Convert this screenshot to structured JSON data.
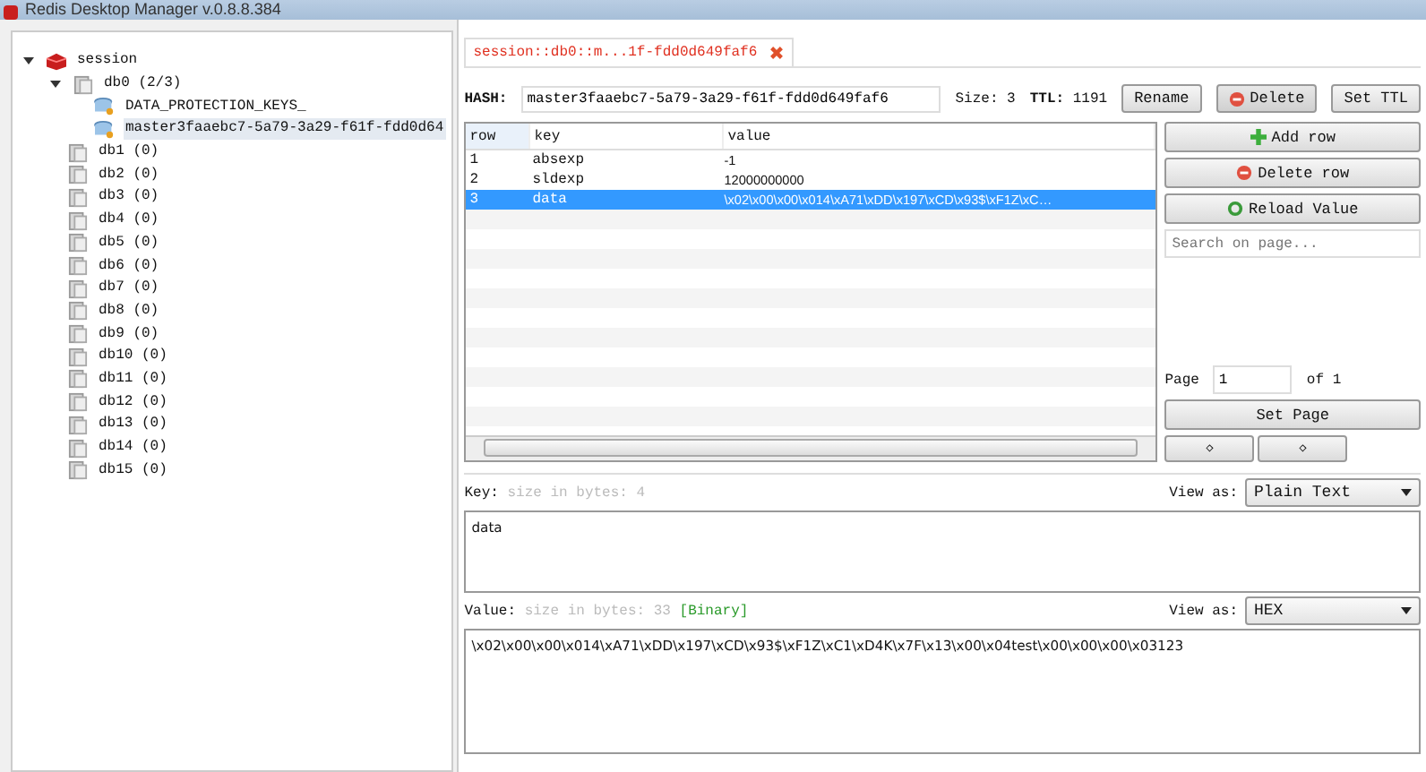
{
  "window": {
    "title": "Redis Desktop Manager v.0.8.8.384"
  },
  "tree": [
    {
      "kind": "server",
      "label": "session",
      "expanded": true,
      "children": [
        {
          "kind": "db",
          "label": "db0  (2/3)",
          "expanded": true,
          "children": [
            {
              "kind": "key",
              "label": "DATA_PROTECTION_KEYS_",
              "selected": false
            },
            {
              "kind": "key",
              "label": "master3faaebc7-5a79-3a29-f61f-fdd0d64",
              "selected": true
            }
          ]
        },
        {
          "kind": "db",
          "label": "db1 (0)",
          "selected": false
        },
        {
          "kind": "db",
          "label": "db2 (0)",
          "selected": false
        },
        {
          "kind": "db",
          "label": "db3 (0)",
          "selected": false
        },
        {
          "kind": "db",
          "label": "db4 (0)",
          "selected": false
        },
        {
          "kind": "db",
          "label": "db5 (0)",
          "selected": false
        },
        {
          "kind": "db",
          "label": "db6 (0)",
          "selected": false
        },
        {
          "kind": "db",
          "label": "db7 (0)",
          "selected": false
        },
        {
          "kind": "db",
          "label": "db8 (0)",
          "selected": false
        },
        {
          "kind": "db",
          "label": "db9 (0)",
          "selected": false
        },
        {
          "kind": "db",
          "label": "db10 (0)",
          "selected": false
        },
        {
          "kind": "db",
          "label": "db11 (0)",
          "selected": false
        },
        {
          "kind": "db",
          "label": "db12 (0)",
          "selected": false
        },
        {
          "kind": "db",
          "label": "db13 (0)",
          "selected": false
        },
        {
          "kind": "db",
          "label": "db14 (0)",
          "selected": false
        },
        {
          "kind": "db",
          "label": "db15 (0)",
          "selected": false
        }
      ]
    }
  ],
  "tabs": [
    {
      "label": "session::db0::m...1f-fdd0d649faf6",
      "selected": true
    }
  ],
  "key_header": {
    "type_label": "HASH:",
    "name": "master3faaebc7-5a79-3a29-f61f-fdd0d649faf6",
    "size_label": "Size:",
    "size": "3",
    "ttl_label": "TTL:",
    "ttl": "1191",
    "buttons": [
      {
        "kind": "plain",
        "label": "Rename"
      },
      {
        "kind": "delete",
        "label": "Delete"
      },
      {
        "kind": "plain",
        "label": "Set TTL"
      }
    ]
  },
  "table": {
    "columns": [
      "row",
      "key",
      "value"
    ],
    "rows": [
      {
        "cells": [
          "1",
          "absexp",
          "-1"
        ],
        "selected": false
      },
      {
        "cells": [
          "2",
          "sldexp",
          "12000000000"
        ],
        "selected": false
      },
      {
        "cells": [
          "3",
          "data",
          "\\x02\\x00\\x00\\x014\\xA71\\xDD\\x197\\xCD\\x93$\\xF1Z\\xC…"
        ],
        "selected": true
      }
    ]
  },
  "side_buttons": [
    {
      "kind": "add",
      "label": "Add row"
    },
    {
      "kind": "delete",
      "label": "Delete row"
    },
    {
      "kind": "reload",
      "label": "Reload Value"
    }
  ],
  "search": {
    "placeholder": "Search on page..."
  },
  "paging": {
    "page_label": "Page",
    "page": "1",
    "of_label": "of 1",
    "set_label": "Set Page",
    "prev": "◇",
    "next": "◇"
  },
  "key_editor": {
    "label": "Key:",
    "hint": "size in bytes: 4",
    "view_label": "View as:",
    "view": "Plain Text",
    "text": "data"
  },
  "value_editor": {
    "label": "Value:",
    "hint": "size in bytes: 33",
    "tag": "[Binary]",
    "view_label": "View as:",
    "view": "HEX",
    "text": "\\x02\\x00\\x00\\x014\\xA71\\xDD\\x197\\xCD\\x93$\\xF1Z\\xC1\\xD4K\\x7F\\x13\\x00\\x04test\\x00\\x00\\x00\\x03123"
  }
}
